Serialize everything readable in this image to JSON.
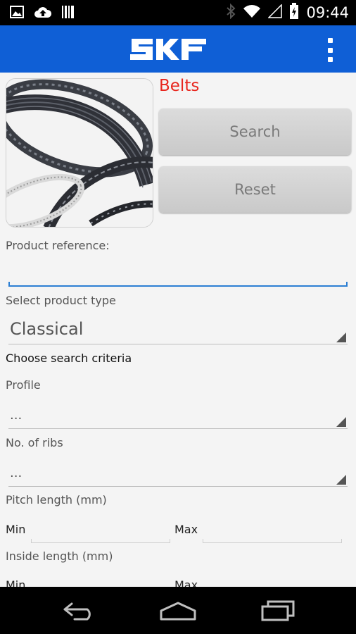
{
  "status_bar": {
    "time": "09:44",
    "icons": [
      "image-icon",
      "cloud-upload-icon",
      "barcode-icon",
      "bluetooth-icon",
      "wifi-icon",
      "signal-icon",
      "battery-icon"
    ]
  },
  "app_bar": {
    "logo_text": "SKF",
    "menu_icon": "overflow-menu-icon",
    "color": "#0f5fd6"
  },
  "header": {
    "category": "Belts"
  },
  "actions": {
    "search_label": "Search",
    "reset_label": "Reset"
  },
  "form": {
    "product_reference_label": "Product reference:",
    "product_reference_value": "",
    "product_type_label": "Select product type",
    "product_type_value": "Classical",
    "criteria_heading": "Choose search criteria",
    "profile_label": "Profile",
    "profile_value": "...",
    "ribs_label": "No. of ribs",
    "ribs_value": "...",
    "pitch_length_label": "Pitch length (mm)",
    "pitch_min_label": "Min",
    "pitch_max_label": "Max",
    "inside_length_label": "Inside length (mm)",
    "inside_min_label": "Min",
    "inside_max_label": "Max"
  },
  "nav_bar": {
    "icons": [
      "back-icon",
      "home-icon",
      "recent-apps-icon"
    ]
  },
  "colors": {
    "accent": "#0f5fd6",
    "title_red": "#e8261e",
    "input_underline": "#2c7fd3"
  }
}
